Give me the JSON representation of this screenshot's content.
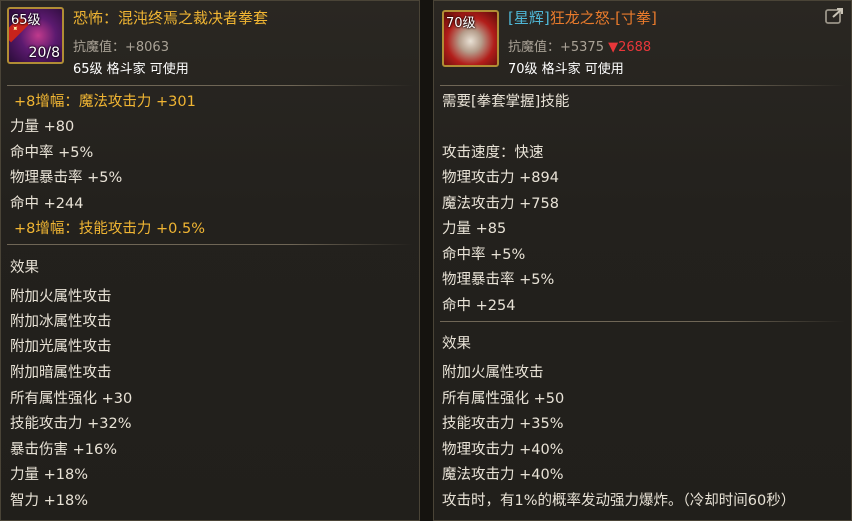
{
  "left": {
    "icon": {
      "name": "gauntlet-purple-icon",
      "level_badge": "65级",
      "count": "20/8"
    },
    "title": "恐怖：混沌终焉之裁决者拳套",
    "resist": "抗魔值：+8063",
    "usage": "65级 格斗家 可使用",
    "amp1": "+8增幅：魔法攻击力 +301",
    "stats": [
      "力量 +80",
      "命中率 +5%",
      "物理暴击率 +5%",
      "命中 +244"
    ],
    "amp2": "+8增幅：技能攻击力 +0.5%",
    "effect_label": "效果",
    "effects": [
      "附加火属性攻击",
      "附加冰属性攻击",
      "附加光属性攻击",
      "附加暗属性攻击",
      "所有属性强化 +30",
      "技能攻击力 +32%",
      "暴击伤害 +16%",
      "力量 +18%",
      "智力 +18%"
    ]
  },
  "right": {
    "icon": {
      "name": "gauntlet-red-icon",
      "level_badge": "70级"
    },
    "title_bracket": "[星辉]",
    "title_main": "狂龙之怒-[寸拳]",
    "resist": "抗魔值：+5375",
    "resist_diff": "▼2688",
    "usage": "70级 格斗家 可使用",
    "requirement": "需要[拳套掌握]技能",
    "stats": [
      "攻击速度：快速",
      "物理攻击力 +894",
      "魔法攻击力 +758",
      "力量 +85",
      "命中率 +5%",
      "物理暴击率 +5%",
      "命中 +254"
    ],
    "effect_label": "效果",
    "effects": [
      "附加火属性攻击",
      "所有属性强化 +50",
      "技能攻击力 +35%",
      "物理攻击力 +40%",
      "魔法攻击力 +40%",
      "攻击时，有1%的概率发动强力爆炸。（冷却时间60秒）"
    ]
  },
  "colors": {
    "gold": "#f0b533",
    "orange": "#e87a2c",
    "cyan": "#4fb7d6",
    "red": "#e8373a",
    "text": "#e8e2d6"
  }
}
